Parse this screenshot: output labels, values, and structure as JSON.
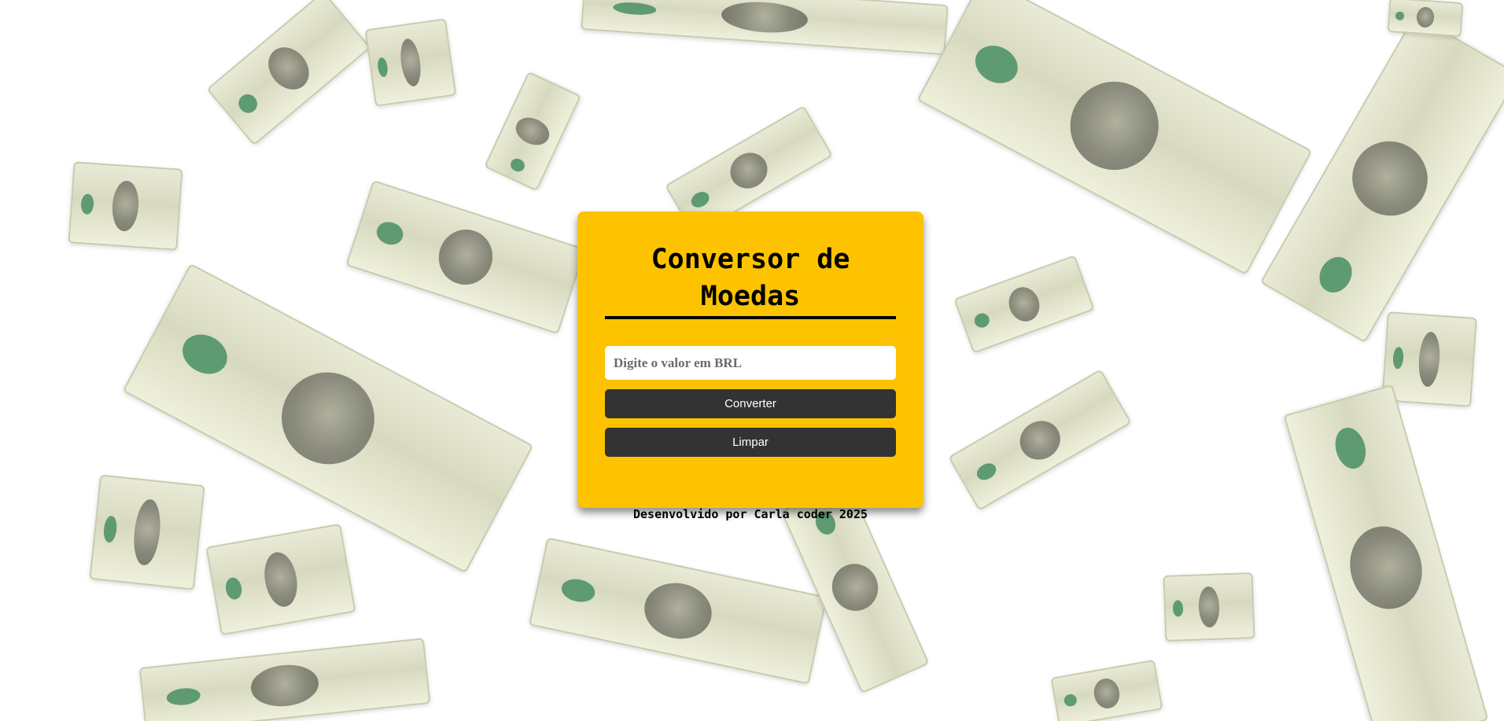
{
  "app": {
    "title": "Conversor de Moedas"
  },
  "form": {
    "input_placeholder": "Digite o valor em BRL",
    "input_value": "",
    "convert_label": "Converter",
    "clear_label": "Limpar"
  },
  "footer": {
    "text": "Desenvolvido por Carla coder 2025"
  },
  "colors": {
    "card_background": "#fdc300",
    "button_background": "#333333",
    "button_text": "#ffffff",
    "page_background": "#ffffff"
  },
  "background": {
    "image_description_icon": "falling-dollar-bills"
  }
}
